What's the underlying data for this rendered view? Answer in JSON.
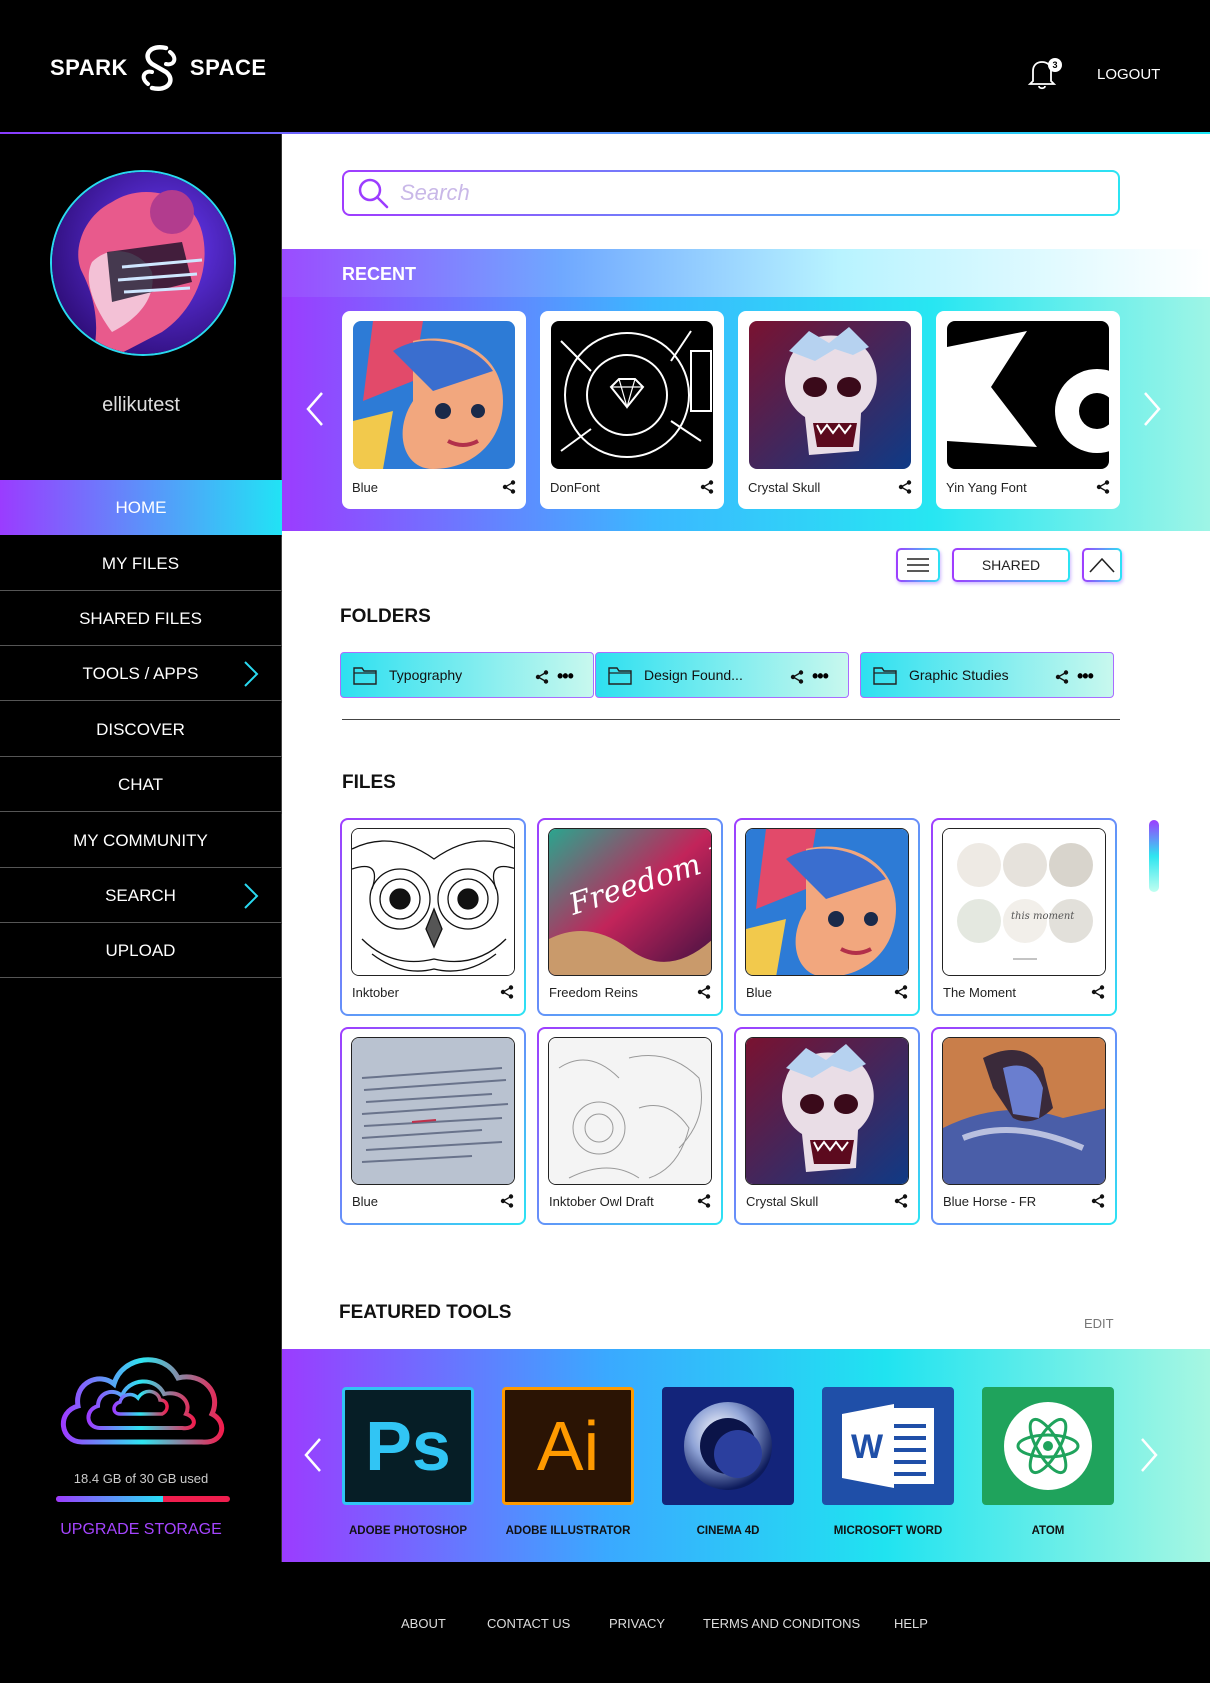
{
  "header": {
    "logo_left": "SPARK",
    "logo_right": "SPACE",
    "notification_count": "3",
    "logout_label": "LOGOUT"
  },
  "sidebar": {
    "username": "ellikutest",
    "nav": [
      {
        "label": "HOME",
        "active": true
      },
      {
        "label": "MY FILES"
      },
      {
        "label": "SHARED FILES"
      },
      {
        "label": "TOOLS / APPS",
        "has_chevron": true
      },
      {
        "label": "DISCOVER"
      },
      {
        "label": "CHAT"
      },
      {
        "label": "MY COMMUNITY"
      },
      {
        "label": "SEARCH",
        "has_chevron": true
      },
      {
        "label": "UPLOAD"
      }
    ],
    "storage": {
      "text": "18.4 GB of 30 GB used",
      "used_fraction": 0.613,
      "upgrade_label": "UPGRADE STORAGE"
    }
  },
  "search": {
    "placeholder": "Search"
  },
  "recent": {
    "title": "RECENT",
    "items": [
      {
        "label": "Blue",
        "icon": "portrait-art"
      },
      {
        "label": "DonFont",
        "icon": "diamond-seal"
      },
      {
        "label": "Crystal Skull",
        "icon": "skull-art"
      },
      {
        "label": "Yin Yang Font",
        "icon": "yinyang-font"
      }
    ]
  },
  "view_controls": {
    "shared_label": "SHARED"
  },
  "folders": {
    "title": "FOLDERS",
    "items": [
      {
        "label": "Typography"
      },
      {
        "label": "Design Found..."
      },
      {
        "label": "Graphic Studies"
      }
    ]
  },
  "files": {
    "title": "FILES",
    "items": [
      {
        "label": "Inktober"
      },
      {
        "label": "Freedom Reins"
      },
      {
        "label": "Blue"
      },
      {
        "label": "The Moment"
      },
      {
        "label": "Blue"
      },
      {
        "label": "Inktober Owl Draft"
      },
      {
        "label": "Crystal Skull"
      },
      {
        "label": "Blue Horse - FR"
      }
    ],
    "freedom_reins_text": "Freedom Reins",
    "moment_text": "this moment"
  },
  "tools": {
    "title": "FEATURED TOOLS",
    "edit_label": "EDIT",
    "items": [
      {
        "label": "ADOBE PHOTOSHOP",
        "glyph": "Ps",
        "bg": "#061e26",
        "fg": "#31c5f4",
        "border": "#31c5f4"
      },
      {
        "label": "ADOBE ILLUSTRATOR",
        "glyph": "Ai",
        "bg": "#2b1404",
        "fg": "#ff9a00",
        "border": "#ff9a00"
      },
      {
        "label": "CINEMA 4D",
        "glyph": "",
        "bg": "#13247a",
        "fg": "#ffffff",
        "border": "#13247a"
      },
      {
        "label": "MICROSOFT WORD",
        "glyph": "W",
        "bg": "#1f4fa8",
        "fg": "#1f4fa8",
        "border": "#1f4fa8"
      },
      {
        "label": "ATOM",
        "glyph": "",
        "bg": "#1fa35c",
        "fg": "#1fa35c",
        "border": "#1fa35c"
      }
    ]
  },
  "footer": {
    "links": [
      "ABOUT",
      "CONTACT US",
      "PRIVACY",
      "TERMS AND CONDITONS",
      "HELP"
    ]
  },
  "colors": {
    "accent_purple": "#9b3cff",
    "accent_cyan": "#20e3f0",
    "storage_red": "#f01e4e"
  }
}
